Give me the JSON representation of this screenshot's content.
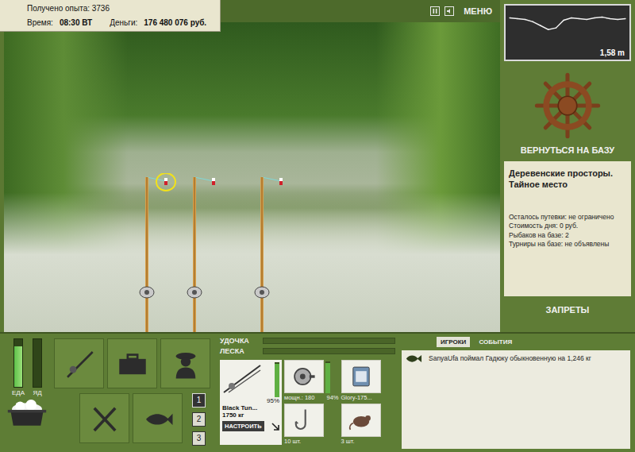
{
  "stats": {
    "experience": "Получено опыта: 3736",
    "time_label": "Время:",
    "time": "08:30 ВТ",
    "money_label": "Деньги:",
    "money": "176 480 076 руб."
  },
  "top_controls": {
    "menu": "МЕНЮ"
  },
  "scene": {
    "rods": [
      {
        "float_highlighted": true
      },
      {
        "float_highlighted": false
      },
      {
        "float_highlighted": false
      }
    ]
  },
  "depth": {
    "values": [
      0.3,
      0.35,
      0.4,
      0.55,
      0.8,
      1.05,
      0.95,
      0.45,
      0.3,
      0.35,
      0.4,
      0.3,
      0.25,
      0.35,
      0.4,
      0.35
    ],
    "reading": "1,58 m"
  },
  "right_panel": {
    "return_button": "ВЕРНУТЬСЯ НА БАЗУ",
    "location": {
      "title": "Деревенские просторы. Тайное место",
      "lines": [
        "Осталось путевки: не ограничено",
        "Стоимость дня: 0 руб.",
        "Рыбаков на базе: 2",
        "Турниры на базе: не объявлены"
      ]
    },
    "bans_button": "ЗАПРЕТЫ"
  },
  "needs": [
    {
      "label": "ЕДА",
      "level": 0.85
    },
    {
      "label": "ЯД",
      "level": 0
    }
  ],
  "slots": [
    {
      "label": "1",
      "selected": true
    },
    {
      "label": "2",
      "selected": false
    },
    {
      "label": "3",
      "selected": false
    }
  ],
  "tension": [
    {
      "label": "УДОЧКА",
      "level": 0
    },
    {
      "label": "ЛЕСКА",
      "level": 0
    }
  ],
  "tackle": {
    "rod": {
      "name": "Black Tun...",
      "capacity": "1750 кг",
      "condition": "95%",
      "level": 0.95,
      "button": "НАСТРОИТЬ"
    },
    "reel": {
      "power": "мощн.: 180",
      "condition": "94%",
      "level": 0.94
    },
    "line": {
      "name": "Glory-175..."
    },
    "hook": {
      "count": "10 шт."
    },
    "bait": {
      "count": "3 шт."
    }
  },
  "log": {
    "tabs": [
      {
        "label": "ИГРОКИ",
        "selected": true
      },
      {
        "label": "СОБЫТИЯ",
        "selected": false
      }
    ],
    "events": [
      {
        "text": "SanyaUfa поймал Гадюку обыкновенную на 1,246 кг"
      }
    ]
  }
}
